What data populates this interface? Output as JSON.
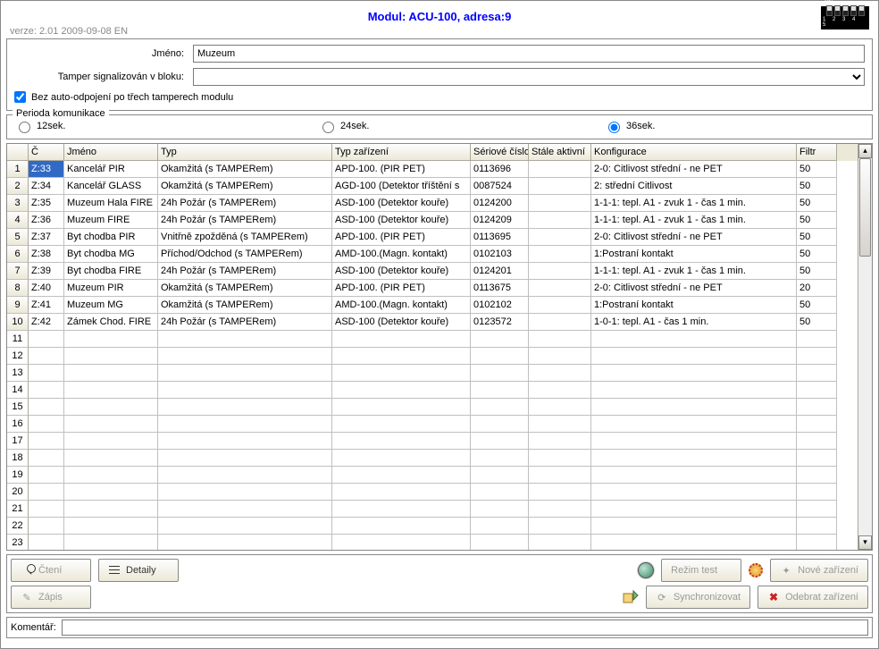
{
  "header": {
    "title": "Modul: ACU-100, adresa:9",
    "version": "verze: 2.01 2009-09-08 EN"
  },
  "form": {
    "name_label": "Jméno:",
    "name_value": "Muzeum",
    "tamper_label": "Tamper signalizován v bloku:",
    "tamper_value": "",
    "auto_disconnect_label": "Bez auto-odpojení po třech tamperech modulu",
    "auto_disconnect_checked": true
  },
  "period": {
    "legend": "Perioda komunikace",
    "opt12": "12sek.",
    "opt24": "24sek.",
    "opt36": "36sek.",
    "selected": "36"
  },
  "table": {
    "headers": {
      "rownum": "",
      "c": "Č",
      "name": "Jméno",
      "typ": "Typ",
      "tzar": "Typ zařízení",
      "ser": "Sériové číslo",
      "stale": "Stále aktivní",
      "konf": "Konfigurace",
      "filtr": "Filtr"
    },
    "rows": [
      {
        "n": "1",
        "c": "Z:33",
        "name": "Kancelář PIR",
        "typ": "Okamžitá (s TAMPERem)",
        "tzar": "APD-100. (PIR PET)",
        "ser": "0113696",
        "stale": "",
        "konf": "2-0: Citlivost střední - ne PET",
        "filtr": "50"
      },
      {
        "n": "2",
        "c": "Z:34",
        "name": "Kancelář GLASS",
        "typ": "Okamžitá (s TAMPERem)",
        "tzar": "AGD-100 (Detektor tříštění s",
        "ser": "0087524",
        "stale": "",
        "konf": "2: střední Citlivost",
        "filtr": "50"
      },
      {
        "n": "3",
        "c": "Z:35",
        "name": "Muzeum Hala FIRE",
        "typ": "24h Požár (s TAMPERem)",
        "tzar": "ASD-100 (Detektor kouře)",
        "ser": "0124200",
        "stale": "",
        "konf": "1-1-1: tepl. A1 - zvuk 1 - čas 1 min.",
        "filtr": "50"
      },
      {
        "n": "4",
        "c": "Z:36",
        "name": "Muzeum FIRE",
        "typ": "24h Požár (s TAMPERem)",
        "tzar": "ASD-100 (Detektor kouře)",
        "ser": "0124209",
        "stale": "",
        "konf": "1-1-1: tepl. A1 - zvuk 1 - čas 1 min.",
        "filtr": "50"
      },
      {
        "n": "5",
        "c": "Z:37",
        "name": "Byt chodba PIR",
        "typ": "Vnitřně zpožděná (s TAMPERem)",
        "tzar": "APD-100. (PIR PET)",
        "ser": "0113695",
        "stale": "",
        "konf": "2-0: Citlivost střední - ne PET",
        "filtr": "50"
      },
      {
        "n": "6",
        "c": "Z:38",
        "name": "Byt chodba MG",
        "typ": "Příchod/Odchod (s TAMPERem)",
        "tzar": "AMD-100.(Magn. kontakt)",
        "ser": "0102103",
        "stale": "",
        "konf": "1:Postraní kontakt",
        "filtr": "50"
      },
      {
        "n": "7",
        "c": "Z:39",
        "name": "Byt chodba FIRE",
        "typ": "24h Požár (s TAMPERem)",
        "tzar": "ASD-100 (Detektor kouře)",
        "ser": "0124201",
        "stale": "",
        "konf": "1-1-1: tepl. A1 - zvuk 1 - čas 1 min.",
        "filtr": "50"
      },
      {
        "n": "8",
        "c": "Z:40",
        "name": "Muzeum PIR",
        "typ": "Okamžitá (s TAMPERem)",
        "tzar": "APD-100. (PIR PET)",
        "ser": "0113675",
        "stale": "",
        "konf": "2-0: Citlivost střední - ne PET",
        "filtr": "20"
      },
      {
        "n": "9",
        "c": "Z:41",
        "name": "Muzeum MG",
        "typ": "Okamžitá (s TAMPERem)",
        "tzar": "AMD-100.(Magn. kontakt)",
        "ser": "0102102",
        "stale": "",
        "konf": "1:Postraní kontakt",
        "filtr": "50"
      },
      {
        "n": "10",
        "c": "Z:42",
        "name": "Zámek Chod. FIRE",
        "typ": "24h Požár (s TAMPERem)",
        "tzar": "ASD-100 (Detektor kouře)",
        "ser": "0123572",
        "stale": "",
        "konf": "1-0-1: tepl. A1 - čas 1 min.",
        "filtr": "50"
      }
    ],
    "empty_from": 11,
    "empty_to": 23
  },
  "buttons": {
    "cteni": "Čtení",
    "detaily": "Detaily",
    "zapis": "Zápis",
    "test": "Režim test",
    "sync": "Synchronizovat",
    "nove": "Nové zařízení",
    "odebrat": "Odebrat zařízení"
  },
  "comment": {
    "label": "Komentář:",
    "value": ""
  }
}
